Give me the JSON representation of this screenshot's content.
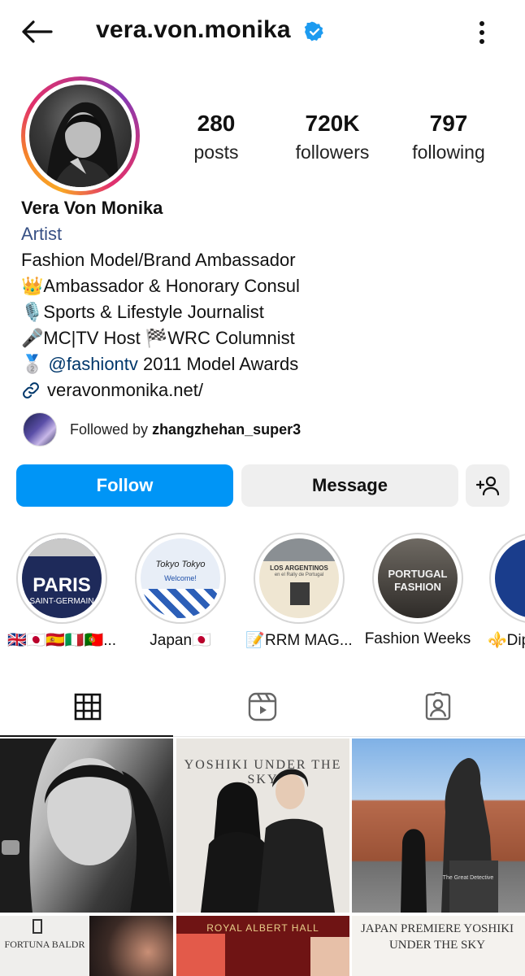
{
  "header": {
    "username": "vera.von.monika",
    "verified_icon": "verified-badge-icon",
    "back_icon": "back-arrow-icon",
    "more_icon": "more-vertical-icon"
  },
  "stats": {
    "posts": {
      "value": "280",
      "label": "posts"
    },
    "followers": {
      "value": "720K",
      "label": "followers"
    },
    "following": {
      "value": "797",
      "label": "following"
    }
  },
  "bio": {
    "name": "Vera Von Monika",
    "category": "Artist",
    "lines": [
      "Fashion Model/Brand Ambassador",
      "👑Ambassador & Honorary Consul",
      "🎙️Sports & Lifestyle Journalist",
      "🎤MC|TV Host 🏁WRC Columnist"
    ],
    "award_prefix": "🥈 ",
    "award_mention": "@fashiontv",
    "award_suffix": " 2011 Model Awards",
    "link": "veravonmonika.net/"
  },
  "followed_by": {
    "prefix": "Followed by ",
    "user": "zhangzhehan_super3"
  },
  "buttons": {
    "follow": "Follow",
    "message": "Message",
    "add_user_icon": "add-user-icon"
  },
  "highlights": [
    {
      "label": "🇬🇧🇯🇵🇪🇸🇮🇹🇵🇹...",
      "cover_text": "PARIS",
      "cover_sub": "SAINT-GERMAIN"
    },
    {
      "label": "Japan🇯🇵",
      "cover_text": "Tokyo Tokyo",
      "cover_sub": "Welcome!"
    },
    {
      "label": "📝RRM MAG...",
      "cover_text": "LOS ARGENTINOS",
      "cover_sub": "en el Rally de Portugal"
    },
    {
      "label": "Fashion Weeks",
      "cover_text": "PORTUGAL",
      "cover_sub": "FASHION"
    },
    {
      "label": "⚜️Dip",
      "cover_text": "",
      "cover_sub": ""
    }
  ],
  "tabs": [
    {
      "name": "grid",
      "icon": "grid-icon",
      "active": true
    },
    {
      "name": "reels",
      "icon": "reels-icon",
      "active": false
    },
    {
      "name": "tagged",
      "icon": "tagged-user-icon",
      "active": false
    }
  ],
  "posts": [
    {
      "caption": ""
    },
    {
      "caption": "YOSHIKI UNDER THE SKY"
    },
    {
      "caption": "The Great Detective"
    },
    {
      "caption": "FORTUNA BALDR"
    },
    {
      "caption": "ROYAL ALBERT HALL"
    },
    {
      "caption": "JAPAN PREMIERE YOSHIKI UNDER THE SKY"
    }
  ],
  "colors": {
    "accent": "#0095f6",
    "link": "#00376b",
    "category": "#385185"
  }
}
